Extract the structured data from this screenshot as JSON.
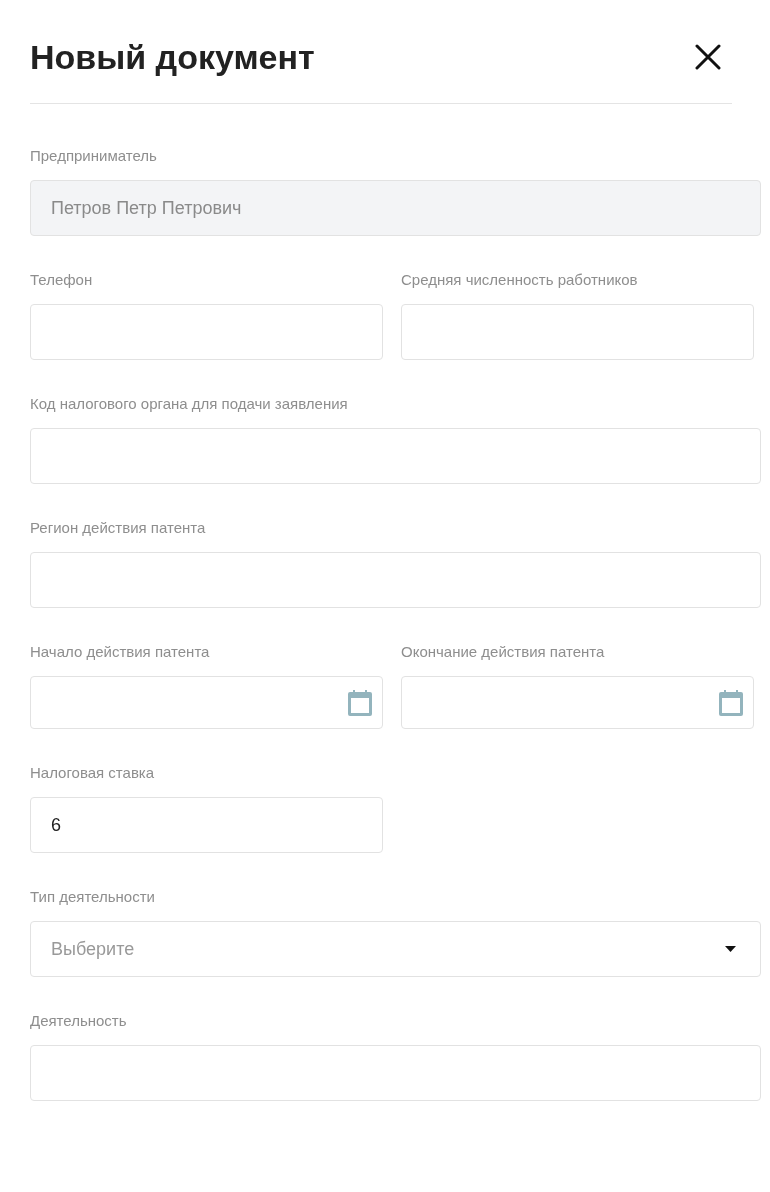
{
  "dialog": {
    "title": "Новый документ"
  },
  "rows": [
    {
      "kind": "wide",
      "fields": [
        {
          "kind": "text",
          "label": "Предприниматель",
          "value": "Петров Петр Петрович",
          "disabled": true
        }
      ]
    },
    {
      "kind": "split",
      "fields": [
        {
          "kind": "text",
          "label": "Телефон",
          "disabled": false
        },
        {
          "kind": "text",
          "label": "Средняя численность работников",
          "disabled": false
        }
      ]
    },
    {
      "kind": "wide",
      "fields": [
        {
          "kind": "text",
          "label": "Код налогового органа для подачи заявления",
          "disabled": false
        }
      ]
    },
    {
      "kind": "wide",
      "fields": [
        {
          "kind": "text",
          "label": "Регион действия патента",
          "disabled": false
        }
      ]
    },
    {
      "kind": "split",
      "fields": [
        {
          "kind": "date",
          "label": "Начало действия патента",
          "disabled": false
        },
        {
          "kind": "date",
          "label": "Окончание действия патента",
          "disabled": false
        }
      ]
    },
    {
      "kind": "split",
      "fields": [
        {
          "kind": "text",
          "label": "Налоговая ставка",
          "value": "6",
          "disabled": false
        }
      ]
    },
    {
      "kind": "wide",
      "fields": [
        {
          "kind": "select",
          "label": "Тип деятельности",
          "placeholder": "Выберите",
          "disabled": false
        }
      ]
    },
    {
      "kind": "wide",
      "fields": [
        {
          "kind": "text",
          "label": "Деятельность",
          "disabled": false
        }
      ]
    }
  ]
}
